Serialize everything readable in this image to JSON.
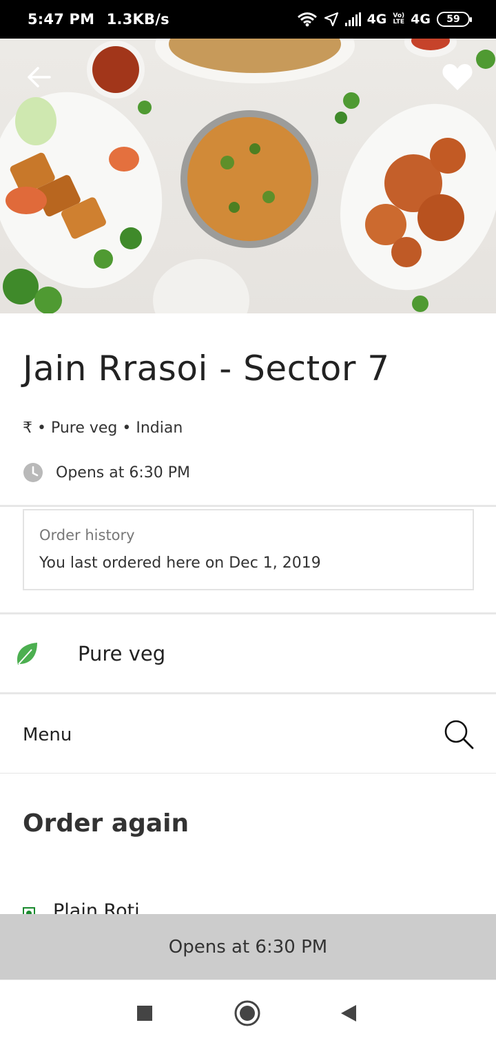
{
  "status_bar": {
    "time": "5:47 PM",
    "speed": "1.3KB/s",
    "network_1": "4G",
    "network_2": "4G",
    "lte_top": "Vo)",
    "lte_bottom": "LTE",
    "battery": "59"
  },
  "restaurant": {
    "name": "Jain Rrasoi - Sector 7",
    "meta": "₹ • Pure veg • Indian",
    "hours": "Opens at 6:30 PM"
  },
  "order_history": {
    "title": "Order history",
    "text": "You last ordered here on Dec 1, 2019"
  },
  "pure_veg": {
    "label": "Pure veg"
  },
  "menu": {
    "label": "Menu"
  },
  "order_again": {
    "title": "Order again",
    "items": [
      {
        "name": "Plain Roti"
      }
    ]
  },
  "banner": {
    "text": "Opens at 6:30 PM"
  },
  "colors": {
    "veg_green": "#1a8a2e",
    "leaf_green": "#4caf50",
    "banner_gray": "#cccccc"
  },
  "icons": {
    "back": "arrow-left-icon",
    "favorite": "heart-icon",
    "clock": "clock-icon",
    "leaf": "leaf-icon",
    "search": "search-icon"
  }
}
